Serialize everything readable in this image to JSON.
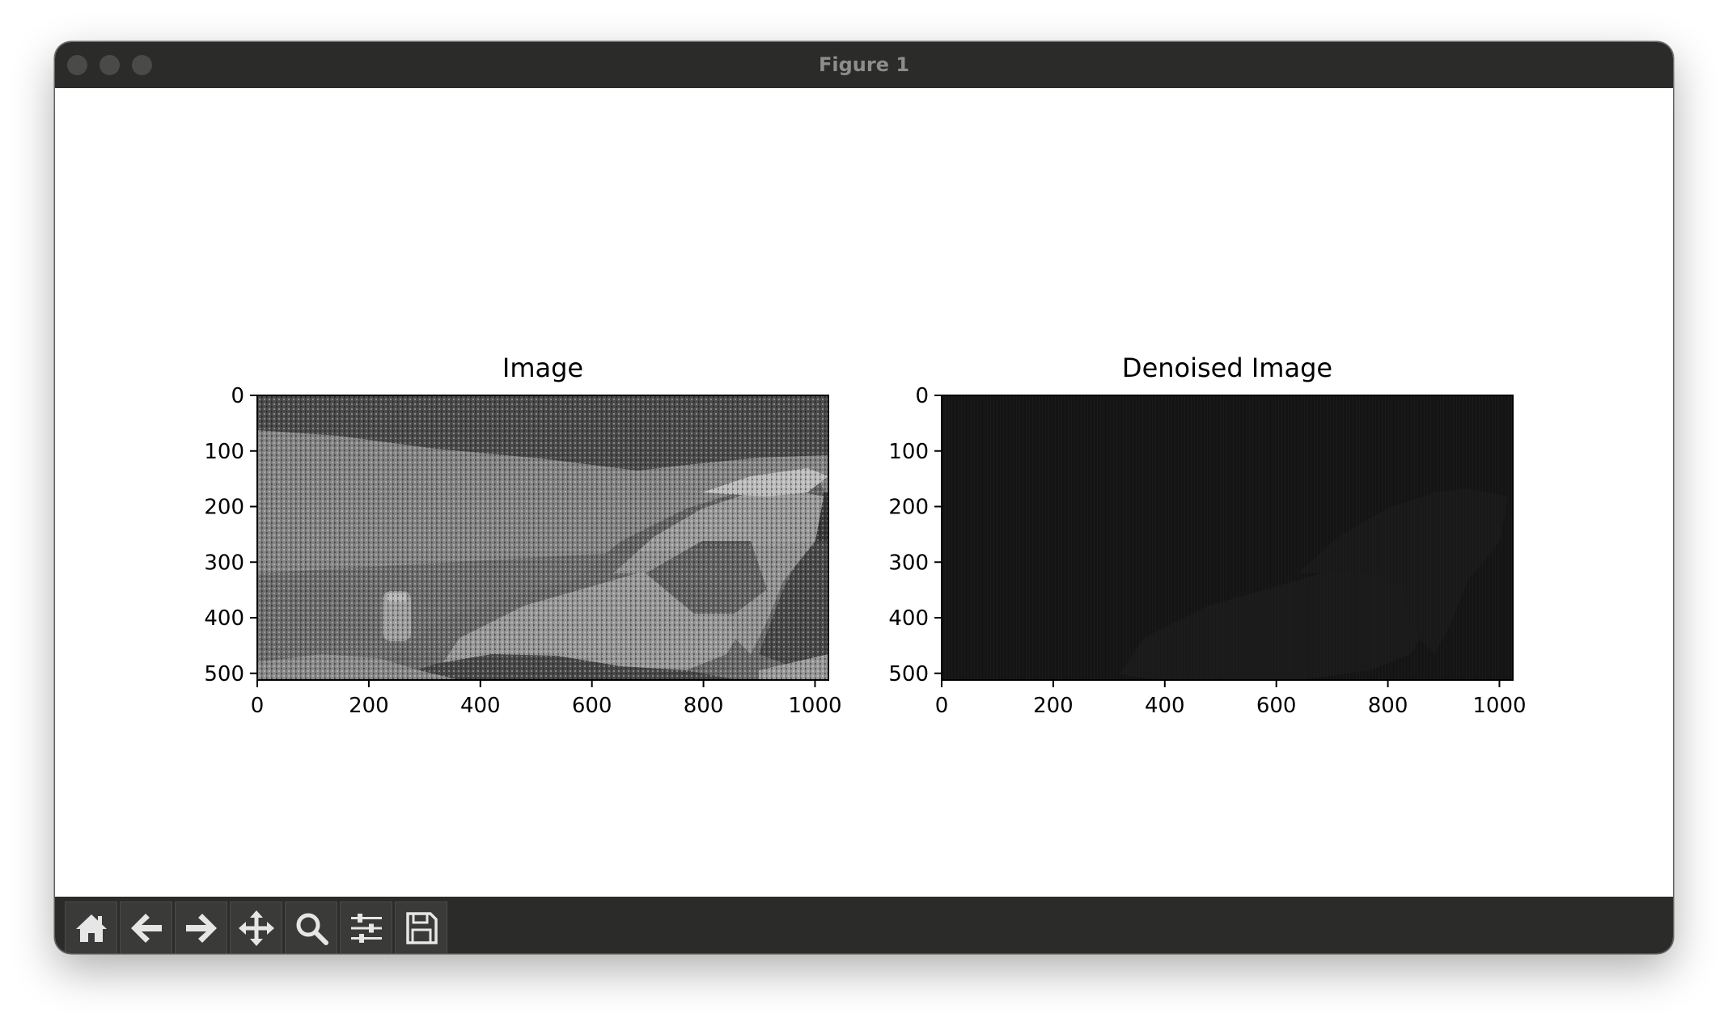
{
  "window": {
    "title": "Figure 1"
  },
  "chart_data": [
    {
      "type": "heatmap",
      "title": "Image",
      "xlabel": "",
      "ylabel": "",
      "xlim": [
        0,
        1024
      ],
      "ylim": [
        512,
        0
      ],
      "xticks": [
        "0",
        "200",
        "400",
        "600",
        "800",
        "1000"
      ],
      "yticks": [
        "0",
        "100",
        "200",
        "300",
        "400",
        "500"
      ],
      "colormap": "gray",
      "content": "grayscale photograph"
    },
    {
      "type": "heatmap",
      "title": "Denoised Image",
      "xlabel": "",
      "ylabel": "",
      "xlim": [
        0,
        1024
      ],
      "ylim": [
        512,
        0
      ],
      "xticks": [
        "0",
        "200",
        "400",
        "600",
        "800",
        "1000"
      ],
      "yticks": [
        "0",
        "100",
        "200",
        "300",
        "400",
        "500"
      ],
      "colormap": "gray",
      "content": "nearly black image"
    }
  ],
  "toolbar": {
    "buttons": [
      {
        "name": "home",
        "icon": "home-icon"
      },
      {
        "name": "back",
        "icon": "arrow-left-icon"
      },
      {
        "name": "forward",
        "icon": "arrow-right-icon"
      },
      {
        "name": "pan",
        "icon": "move-icon"
      },
      {
        "name": "zoom",
        "icon": "magnifier-icon"
      },
      {
        "name": "configure-subplots",
        "icon": "sliders-icon"
      },
      {
        "name": "save",
        "icon": "floppy-disk-icon"
      }
    ]
  }
}
